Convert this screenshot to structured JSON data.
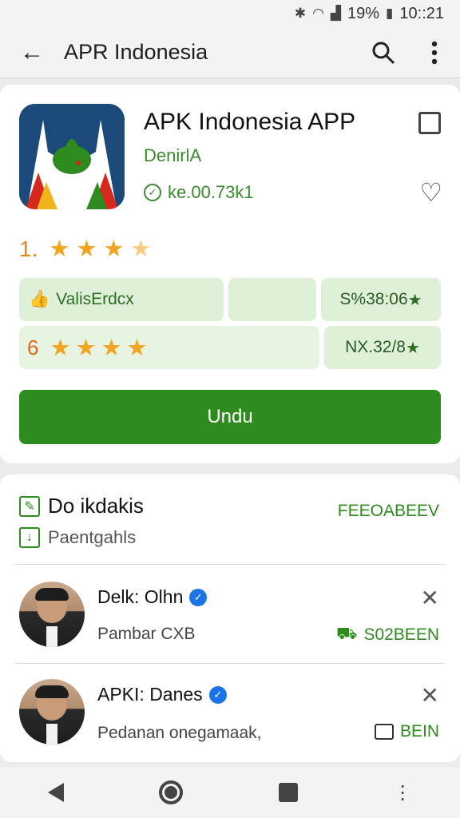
{
  "status": {
    "bluetooth_icon": "bluetooth-icon",
    "wifi_icon": "wifi-icon",
    "signal_icon": "signal-icon",
    "battery_pct": "19%",
    "time": "10::21"
  },
  "toolbar": {
    "title": "APR Indonesia",
    "back_icon": "arrow-left-icon",
    "search_icon": "search-icon",
    "more_icon": "more-vert-icon"
  },
  "app": {
    "name": "APK Indonesia APP",
    "developer": "DenirlA",
    "version": "ke.00.73k1",
    "rating": "1.",
    "stars": 3.5,
    "stat1_label": "ValisErdcx",
    "stat1_value": "S%38:06",
    "stat2_rating": "6",
    "stat2_value": "NX.32/8",
    "install_label": "Undu"
  },
  "section": {
    "title": "Do ikdakis",
    "subtitle": "Paentgahls",
    "link": "FEEOABEEV"
  },
  "reviews": [
    {
      "name": "Delk: Olhn",
      "subtitle": "Pambar CXB",
      "action": "S02BEEN"
    },
    {
      "name": "APKI: Danes",
      "subtitle": "Pedanan onegamaak,",
      "action": "BEIN"
    }
  ],
  "colors": {
    "accent_green": "#2e8b1d",
    "star_orange": "#f0a421",
    "pill_green": "#dff0d8"
  }
}
